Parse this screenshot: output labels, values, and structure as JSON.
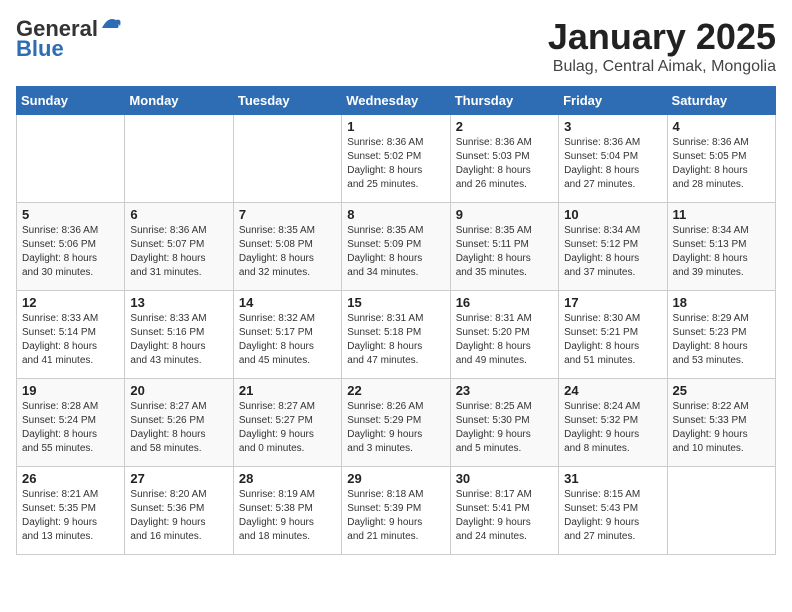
{
  "header": {
    "logo_general": "General",
    "logo_blue": "Blue",
    "title": "January 2025",
    "subtitle": "Bulag, Central Aimak, Mongolia"
  },
  "weekdays": [
    "Sunday",
    "Monday",
    "Tuesday",
    "Wednesday",
    "Thursday",
    "Friday",
    "Saturday"
  ],
  "weeks": [
    [
      {
        "day": "",
        "info": ""
      },
      {
        "day": "",
        "info": ""
      },
      {
        "day": "",
        "info": ""
      },
      {
        "day": "1",
        "info": "Sunrise: 8:36 AM\nSunset: 5:02 PM\nDaylight: 8 hours\nand 25 minutes."
      },
      {
        "day": "2",
        "info": "Sunrise: 8:36 AM\nSunset: 5:03 PM\nDaylight: 8 hours\nand 26 minutes."
      },
      {
        "day": "3",
        "info": "Sunrise: 8:36 AM\nSunset: 5:04 PM\nDaylight: 8 hours\nand 27 minutes."
      },
      {
        "day": "4",
        "info": "Sunrise: 8:36 AM\nSunset: 5:05 PM\nDaylight: 8 hours\nand 28 minutes."
      }
    ],
    [
      {
        "day": "5",
        "info": "Sunrise: 8:36 AM\nSunset: 5:06 PM\nDaylight: 8 hours\nand 30 minutes."
      },
      {
        "day": "6",
        "info": "Sunrise: 8:36 AM\nSunset: 5:07 PM\nDaylight: 8 hours\nand 31 minutes."
      },
      {
        "day": "7",
        "info": "Sunrise: 8:35 AM\nSunset: 5:08 PM\nDaylight: 8 hours\nand 32 minutes."
      },
      {
        "day": "8",
        "info": "Sunrise: 8:35 AM\nSunset: 5:09 PM\nDaylight: 8 hours\nand 34 minutes."
      },
      {
        "day": "9",
        "info": "Sunrise: 8:35 AM\nSunset: 5:11 PM\nDaylight: 8 hours\nand 35 minutes."
      },
      {
        "day": "10",
        "info": "Sunrise: 8:34 AM\nSunset: 5:12 PM\nDaylight: 8 hours\nand 37 minutes."
      },
      {
        "day": "11",
        "info": "Sunrise: 8:34 AM\nSunset: 5:13 PM\nDaylight: 8 hours\nand 39 minutes."
      }
    ],
    [
      {
        "day": "12",
        "info": "Sunrise: 8:33 AM\nSunset: 5:14 PM\nDaylight: 8 hours\nand 41 minutes."
      },
      {
        "day": "13",
        "info": "Sunrise: 8:33 AM\nSunset: 5:16 PM\nDaylight: 8 hours\nand 43 minutes."
      },
      {
        "day": "14",
        "info": "Sunrise: 8:32 AM\nSunset: 5:17 PM\nDaylight: 8 hours\nand 45 minutes."
      },
      {
        "day": "15",
        "info": "Sunrise: 8:31 AM\nSunset: 5:18 PM\nDaylight: 8 hours\nand 47 minutes."
      },
      {
        "day": "16",
        "info": "Sunrise: 8:31 AM\nSunset: 5:20 PM\nDaylight: 8 hours\nand 49 minutes."
      },
      {
        "day": "17",
        "info": "Sunrise: 8:30 AM\nSunset: 5:21 PM\nDaylight: 8 hours\nand 51 minutes."
      },
      {
        "day": "18",
        "info": "Sunrise: 8:29 AM\nSunset: 5:23 PM\nDaylight: 8 hours\nand 53 minutes."
      }
    ],
    [
      {
        "day": "19",
        "info": "Sunrise: 8:28 AM\nSunset: 5:24 PM\nDaylight: 8 hours\nand 55 minutes."
      },
      {
        "day": "20",
        "info": "Sunrise: 8:27 AM\nSunset: 5:26 PM\nDaylight: 8 hours\nand 58 minutes."
      },
      {
        "day": "21",
        "info": "Sunrise: 8:27 AM\nSunset: 5:27 PM\nDaylight: 9 hours\nand 0 minutes."
      },
      {
        "day": "22",
        "info": "Sunrise: 8:26 AM\nSunset: 5:29 PM\nDaylight: 9 hours\nand 3 minutes."
      },
      {
        "day": "23",
        "info": "Sunrise: 8:25 AM\nSunset: 5:30 PM\nDaylight: 9 hours\nand 5 minutes."
      },
      {
        "day": "24",
        "info": "Sunrise: 8:24 AM\nSunset: 5:32 PM\nDaylight: 9 hours\nand 8 minutes."
      },
      {
        "day": "25",
        "info": "Sunrise: 8:22 AM\nSunset: 5:33 PM\nDaylight: 9 hours\nand 10 minutes."
      }
    ],
    [
      {
        "day": "26",
        "info": "Sunrise: 8:21 AM\nSunset: 5:35 PM\nDaylight: 9 hours\nand 13 minutes."
      },
      {
        "day": "27",
        "info": "Sunrise: 8:20 AM\nSunset: 5:36 PM\nDaylight: 9 hours\nand 16 minutes."
      },
      {
        "day": "28",
        "info": "Sunrise: 8:19 AM\nSunset: 5:38 PM\nDaylight: 9 hours\nand 18 minutes."
      },
      {
        "day": "29",
        "info": "Sunrise: 8:18 AM\nSunset: 5:39 PM\nDaylight: 9 hours\nand 21 minutes."
      },
      {
        "day": "30",
        "info": "Sunrise: 8:17 AM\nSunset: 5:41 PM\nDaylight: 9 hours\nand 24 minutes."
      },
      {
        "day": "31",
        "info": "Sunrise: 8:15 AM\nSunset: 5:43 PM\nDaylight: 9 hours\nand 27 minutes."
      },
      {
        "day": "",
        "info": ""
      }
    ]
  ]
}
